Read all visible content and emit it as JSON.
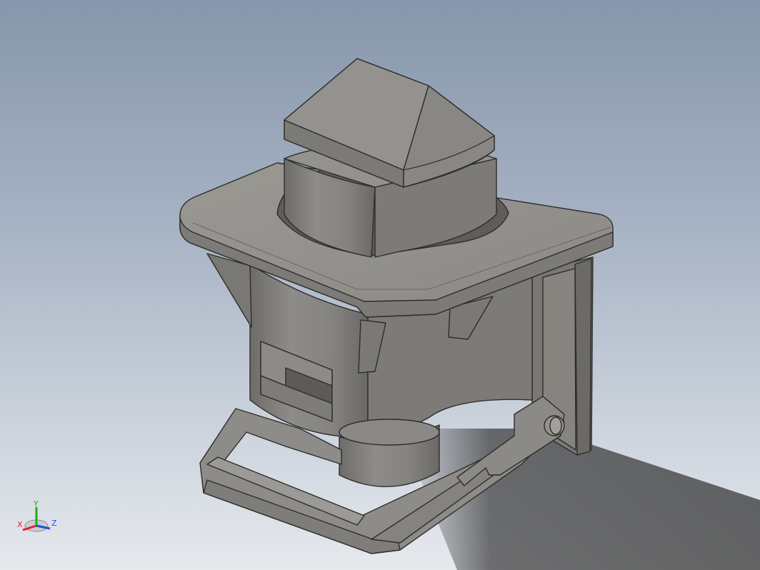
{
  "viewport": {
    "background_top": "#8796ab",
    "background_bottom": "#e6e9ed",
    "model_color": "#8a8884",
    "edge_color": "#2e2d2b"
  },
  "triad": {
    "x_label": "X",
    "y_label": "Y",
    "z_label": "Z",
    "x_color": "#e02020",
    "y_color": "#18b018",
    "z_color": "#2050e0"
  }
}
